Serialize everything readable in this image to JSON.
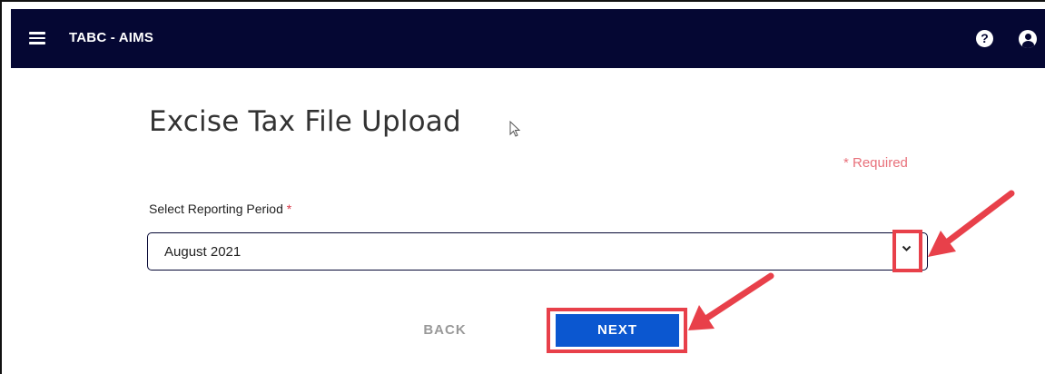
{
  "header": {
    "app_title": "TABC - AIMS",
    "menu_icon": "hamburger-menu-icon",
    "help_icon": "help-icon",
    "help_glyph": "?",
    "account_icon": "user-account-icon"
  },
  "main": {
    "title": "Excise Tax File Upload",
    "required_note": "* Required",
    "reporting_period": {
      "label": "Select Reporting Period",
      "required_marker": "*",
      "selected_value": "August 2021"
    },
    "actions": {
      "back_label": "BACK",
      "next_label": "NEXT"
    }
  },
  "colors": {
    "header_bg": "#050733",
    "next_button": "#0b57d0",
    "annotation": "#e8404a",
    "required": "#e8707a"
  }
}
